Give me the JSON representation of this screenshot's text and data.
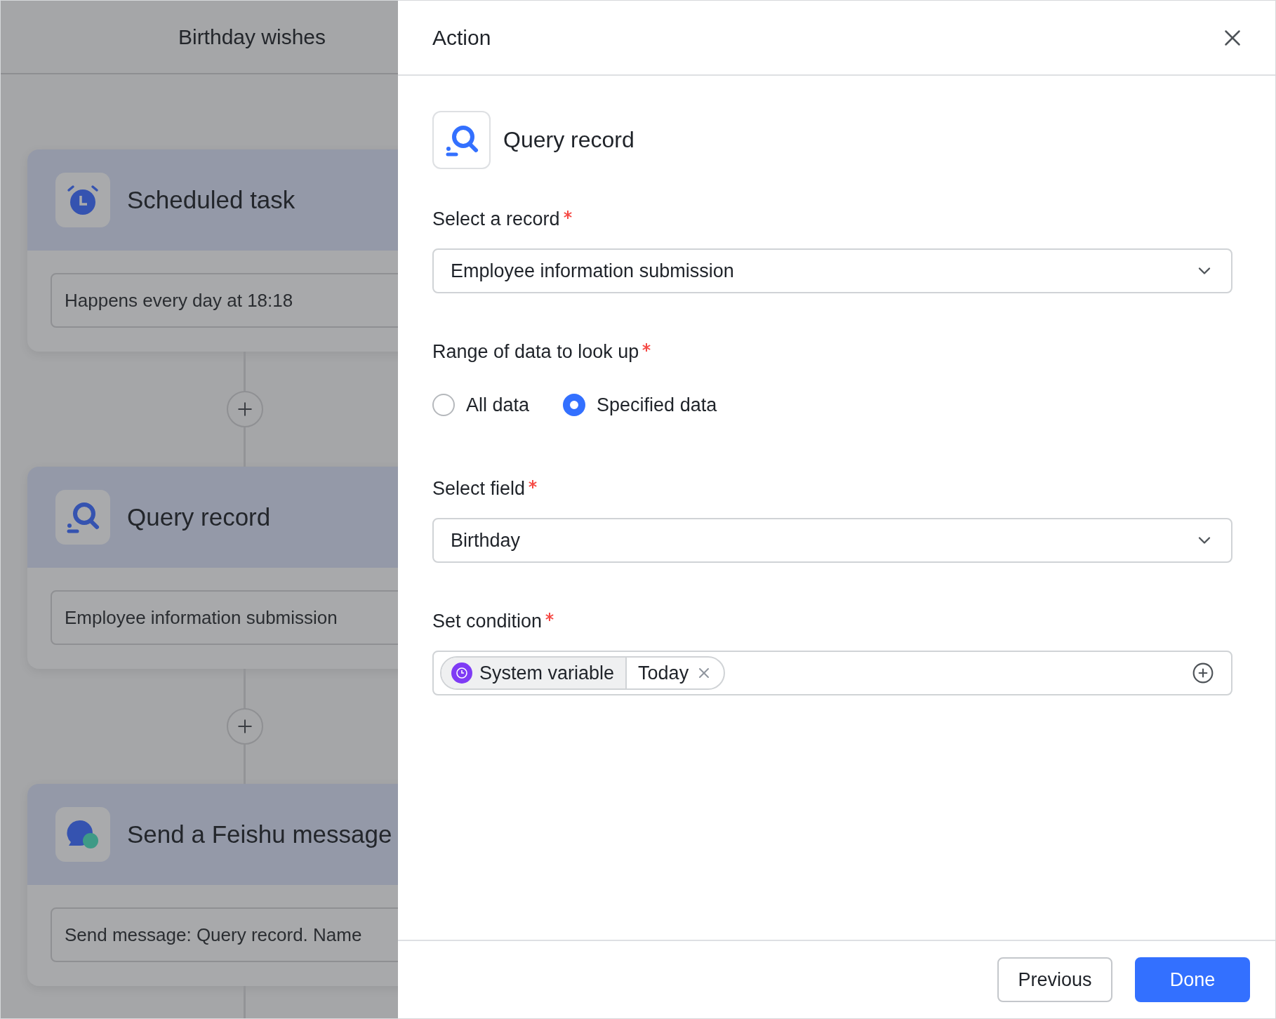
{
  "canvas": {
    "title": "Birthday wishes",
    "steps": [
      {
        "kind": "schedule",
        "title": "Scheduled task",
        "summary": "Happens every day at 18:18"
      },
      {
        "kind": "query",
        "title": "Query record",
        "summary": "Employee information submission"
      },
      {
        "kind": "message",
        "title": "Send a Feishu message",
        "summary": "Send message: Query record. Name"
      }
    ]
  },
  "drawer": {
    "title": "Action",
    "action": {
      "kind": "query",
      "title": "Query record"
    },
    "fields": [
      {
        "kind": "select",
        "label": "Select a record",
        "required": true,
        "value": "Employee information submission"
      },
      {
        "kind": "radio",
        "label": "Range of data to look up",
        "required": true,
        "options": [
          {
            "label": "All data",
            "selected": false
          },
          {
            "label": "Specified data",
            "selected": true
          }
        ]
      },
      {
        "kind": "select",
        "label": "Select field",
        "required": true,
        "value": "Birthday"
      },
      {
        "kind": "condition",
        "label": "Set condition",
        "required": true,
        "tag": {
          "source": "System variable",
          "value": "Today"
        }
      }
    ],
    "buttons": [
      {
        "label": "Previous",
        "primary": false
      },
      {
        "label": "Done",
        "primary": true
      }
    ]
  }
}
